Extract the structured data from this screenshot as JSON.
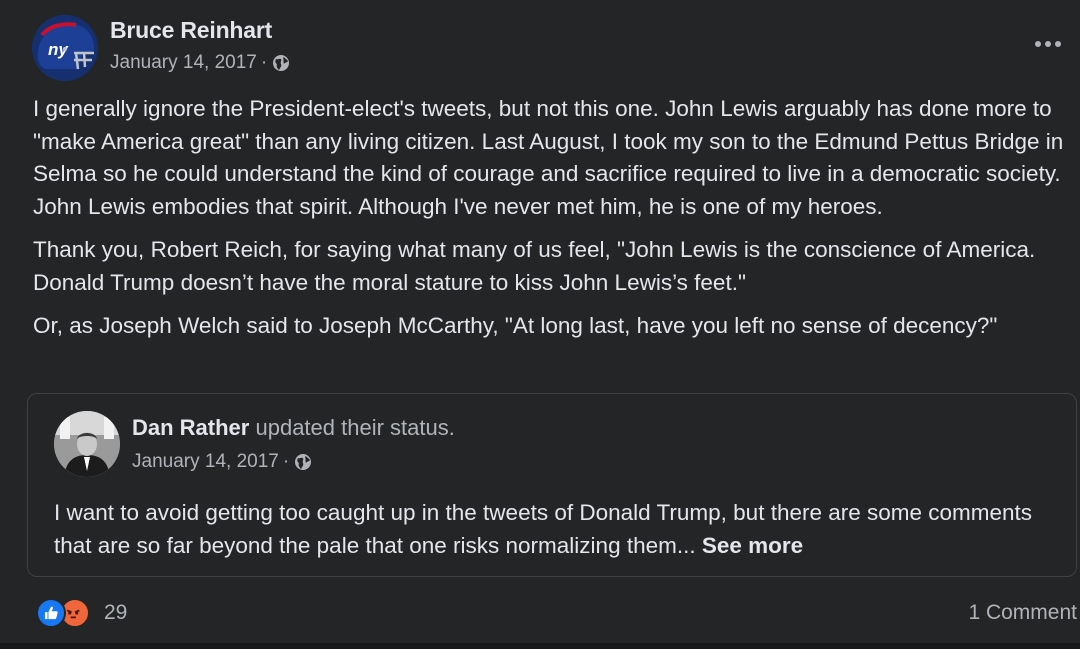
{
  "post": {
    "author": "Bruce Reinhart",
    "date": "January 14, 2017",
    "separator": "·",
    "privacy_icon": "globe-icon",
    "paragraphs": [
      "I generally ignore the President-elect's tweets, but not this one. John Lewis arguably has done more to \"make America great\" than any living citizen. Last August, I took my son to the Edmund Pettus Bridge in Selma so he could understand the kind of courage and sacrifice required to live in a democratic society.  John Lewis embodies that spirit. Although I've never met him, he is one of my heroes.",
      "Thank you, Robert Reich, for saying what many of us feel, \"John Lewis is the conscience of America. Donald Trump doesn’t have the moral stature to kiss John Lewis’s feet.\"",
      "Or, as Joseph Welch said to Joseph McCarthy, \"At long last, have you left no sense of decency?\""
    ]
  },
  "shared": {
    "author": "Dan Rather",
    "action": "updated their status.",
    "date": "January 14, 2017",
    "separator": "·",
    "text": "I want to avoid getting too caught up in the tweets of Donald Trump, but there are some comments that are so far beyond the pale that one risks normalizing them...",
    "see_more": "See more"
  },
  "footer": {
    "reactions": [
      "like-icon",
      "angry-icon"
    ],
    "reaction_count": "29",
    "comments": "1 Comment"
  },
  "colors": {
    "background": "#242526",
    "text": "#e4e6eb",
    "secondary_text": "#b0b3b8",
    "like": "#1877f2",
    "angry": "#f0653a"
  }
}
